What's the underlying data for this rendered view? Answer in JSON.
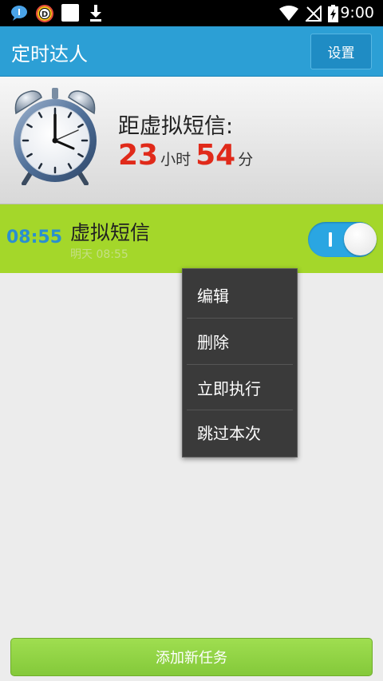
{
  "status_bar": {
    "time": "9:00",
    "icons": [
      "message-icon",
      "d-app-icon",
      "blank-app-icon",
      "download-icon",
      "wifi-icon",
      "no-signal-icon",
      "battery-charging-icon"
    ]
  },
  "app_bar": {
    "title": "定时达人",
    "settings_label": "设置"
  },
  "countdown": {
    "title": "距虚拟短信:",
    "hours": "23",
    "hours_unit": "小时",
    "minutes": "54",
    "minutes_unit": "分",
    "icon": "alarm-clock-icon"
  },
  "task": {
    "time": "08:55",
    "name": "虚拟短信",
    "subtitle": "明天 08:55",
    "enabled": true
  },
  "context_menu": {
    "items": [
      {
        "label": "编辑"
      },
      {
        "label": "删除"
      },
      {
        "label": "立即执行"
      },
      {
        "label": "跳过本次"
      }
    ]
  },
  "footer": {
    "add_label": "添加新任务"
  },
  "colors": {
    "app_bar": "#2c9fd5",
    "task_row": "#a4d72a",
    "countdown_number": "#e02a1a",
    "task_time": "#2a8fd0",
    "add_button": "#8dd240"
  }
}
